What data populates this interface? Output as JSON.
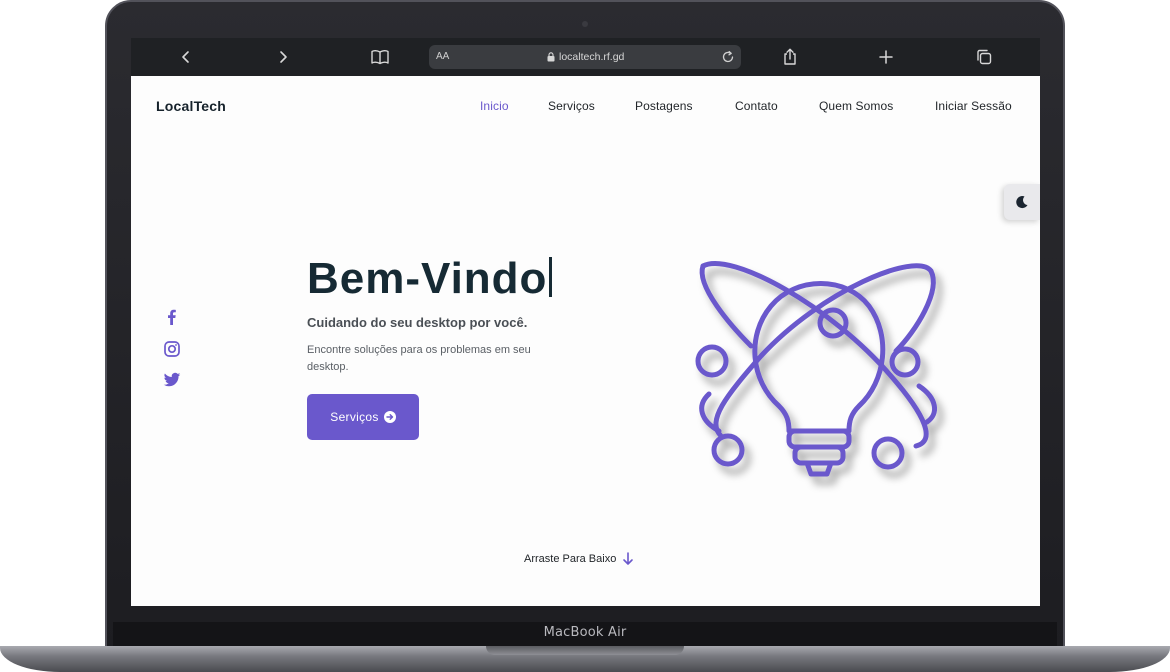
{
  "device": {
    "label": "MacBook Air"
  },
  "browser": {
    "url_text_size": "AA",
    "url": "localtech.rf.gd"
  },
  "site": {
    "logo": "LocalTech",
    "nav": [
      {
        "label": "Inicio",
        "active": true
      },
      {
        "label": "Serviços"
      },
      {
        "label": "Postagens"
      },
      {
        "label": "Contato"
      },
      {
        "label": "Quem Somos"
      },
      {
        "label": "Iniciar Sessão"
      }
    ],
    "socials": [
      "facebook-icon",
      "instagram-icon",
      "twitter-icon"
    ]
  },
  "hero": {
    "title": "Bem-Vindo",
    "subtitle": "Cuidando do seu desktop por você.",
    "description": "Encontre soluções para os problemas em seu desktop.",
    "cta_label": "Serviços"
  },
  "scroll_hint": "Arraste Para Baixo",
  "colors": {
    "accent": "#6a58cc",
    "heading": "#162a34",
    "toolbar": "#1f2124"
  }
}
